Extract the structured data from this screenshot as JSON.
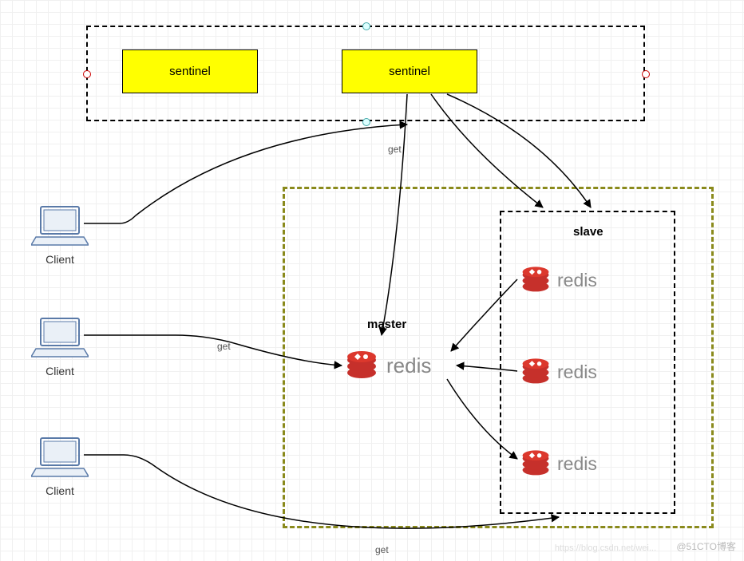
{
  "sentinels": {
    "box1_label": "sentinel",
    "box2_label": "sentinel"
  },
  "clients": {
    "c1_label": "Client",
    "c2_label": "Client",
    "c3_label": "Client"
  },
  "cluster": {
    "master_label": "master",
    "slave_label": "slave",
    "redis_text": "redis"
  },
  "edges": {
    "get1": "get",
    "get2": "get",
    "get3": "get"
  },
  "watermark": "@51CTO博客",
  "watermark2": "https://blog.csdn.net/wei..."
}
